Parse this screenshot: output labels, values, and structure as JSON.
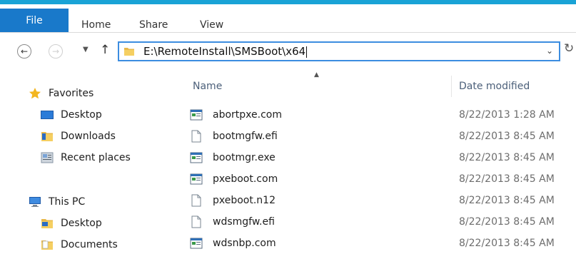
{
  "ribbon": {
    "tabs": [
      "File",
      "Home",
      "Share",
      "View"
    ],
    "accent_color": "#19a3d6",
    "file_tab_color": "#1979ca"
  },
  "address_bar": {
    "path": "E:\\RemoteInstall\\SMSBoot\\x64",
    "back_icon": "back-arrow-icon",
    "forward_icon": "forward-arrow-icon",
    "recent_icon": "chevron-down-icon",
    "up_icon": "up-arrow-icon",
    "refresh_icon": "refresh-icon"
  },
  "navigation": {
    "favorites": {
      "label": "Favorites",
      "icon": "star-icon",
      "items": [
        {
          "label": "Desktop",
          "icon": "desktop-icon"
        },
        {
          "label": "Downloads",
          "icon": "downloads-folder-icon"
        },
        {
          "label": "Recent places",
          "icon": "recent-places-icon"
        }
      ]
    },
    "this_pc": {
      "label": "This PC",
      "icon": "computer-icon",
      "items": [
        {
          "label": "Desktop",
          "icon": "desktop-folder-icon"
        },
        {
          "label": "Documents",
          "icon": "documents-folder-icon"
        }
      ]
    }
  },
  "file_list": {
    "columns": [
      "Name",
      "Date modified"
    ],
    "sorted_by": "Name",
    "files": [
      {
        "name": "abortpxe.com",
        "date": "8/22/2013 1:28 AM",
        "icon": "application-icon"
      },
      {
        "name": "bootmgfw.efi",
        "date": "8/22/2013 8:45 AM",
        "icon": "file-icon"
      },
      {
        "name": "bootmgr.exe",
        "date": "8/22/2013 8:45 AM",
        "icon": "application-icon"
      },
      {
        "name": "pxeboot.com",
        "date": "8/22/2013 8:45 AM",
        "icon": "application-icon"
      },
      {
        "name": "pxeboot.n12",
        "date": "8/22/2013 8:45 AM",
        "icon": "file-icon"
      },
      {
        "name": "wdsmgfw.efi",
        "date": "8/22/2013 8:45 AM",
        "icon": "file-icon"
      },
      {
        "name": "wdsnbp.com",
        "date": "8/22/2013 8:45 AM",
        "icon": "application-icon"
      }
    ]
  }
}
